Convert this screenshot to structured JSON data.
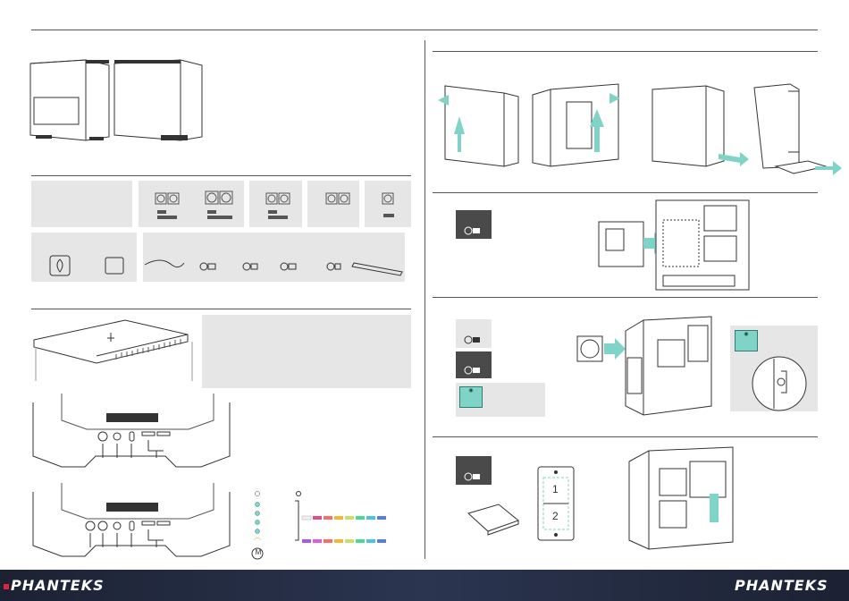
{
  "brand": {
    "left_logo": "PHANTEKS",
    "right_logo": "PHANTEKS"
  },
  "steps": {
    "ssd_slot_1": "1",
    "ssd_slot_2": "2",
    "mode_button_letter": "M"
  },
  "icons": {
    "tip": "lightbulb-icon",
    "screw": "screw-icon",
    "arrow": "arrow-icon"
  },
  "colors": {
    "accent_arrow": "#7fd3c7",
    "footer": "#1c2233",
    "rgb_strip": [
      "#f2f2f2",
      "#e84a8a",
      "#ff6b6b",
      "#f7b733",
      "#c8e06b",
      "#4ad991",
      "#4ac3e8",
      "#5b7ce8",
      "#a45be8",
      "#e85bd6"
    ]
  }
}
